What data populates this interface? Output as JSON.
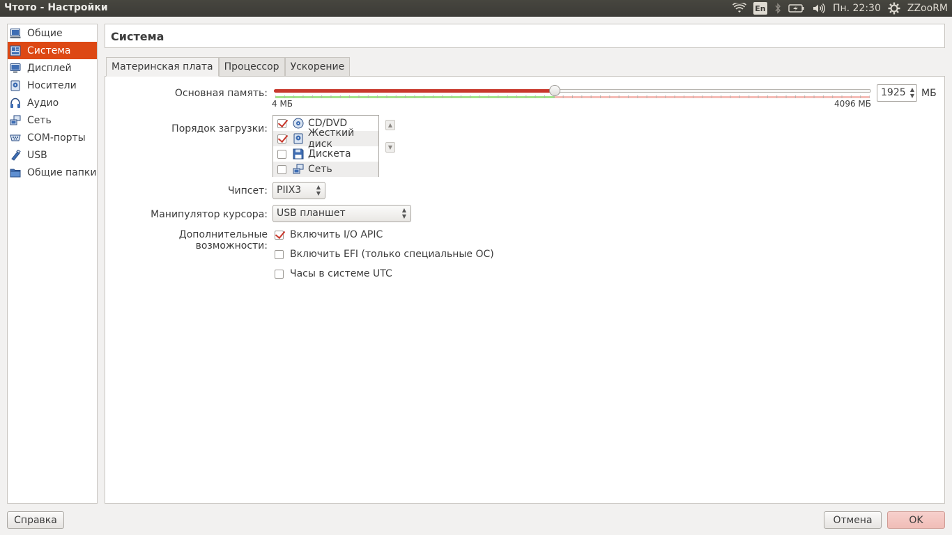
{
  "window": {
    "title": "Чтото - Настройки"
  },
  "tray": {
    "lang": "En",
    "clock": "Пн. 22:30",
    "user": "ZZooRM"
  },
  "sidebar": {
    "items": [
      {
        "label": "Общие",
        "icon": "general-icon"
      },
      {
        "label": "Система",
        "icon": "system-icon",
        "active": true
      },
      {
        "label": "Дисплей",
        "icon": "display-icon"
      },
      {
        "label": "Носители",
        "icon": "storage-icon"
      },
      {
        "label": "Аудио",
        "icon": "audio-icon"
      },
      {
        "label": "Сеть",
        "icon": "network-icon"
      },
      {
        "label": "COM-порты",
        "icon": "serial-port-icon"
      },
      {
        "label": "USB",
        "icon": "usb-icon"
      },
      {
        "label": "Общие папки",
        "icon": "shared-folder-icon"
      }
    ]
  },
  "header": {
    "title": "Система"
  },
  "tabs": [
    {
      "label": "Материнская плата",
      "active": true
    },
    {
      "label": "Процессор"
    },
    {
      "label": "Ускорение"
    }
  ],
  "motherboard": {
    "memory": {
      "label": "Основная память:",
      "value": "1925",
      "unit": "МБ",
      "min_label": "4 МБ",
      "max_label": "4096 МБ",
      "fraction": 0.47
    },
    "boot_order": {
      "label": "Порядок загрузки:",
      "items": [
        {
          "label": "CD/DVD",
          "checked": true,
          "icon": "cd-dvd-icon"
        },
        {
          "label": "Жесткий диск",
          "checked": true,
          "icon": "hard-disk-icon"
        },
        {
          "label": "Дискета",
          "checked": false,
          "icon": "floppy-icon"
        },
        {
          "label": "Сеть",
          "checked": false,
          "icon": "network-icon"
        }
      ]
    },
    "chipset": {
      "label": "Чипсет:",
      "value": "PIIX3"
    },
    "pointing": {
      "label": "Манипулятор курсора:",
      "value": "USB планшет"
    },
    "extended": {
      "label": "Дополнительные возможности:",
      "options": [
        {
          "label": "Включить I/O APIC",
          "checked": true
        },
        {
          "label": "Включить EFI (только специальные ОС)",
          "checked": false
        },
        {
          "label": "Часы в системе UTC",
          "checked": false
        }
      ]
    }
  },
  "buttons": {
    "help": "Справка",
    "cancel": "Отмена",
    "ok": "OK"
  },
  "colors": {
    "accent": "#dd4814",
    "slider_fill": "#c8382c",
    "ok_button": "#f0bdb7"
  }
}
